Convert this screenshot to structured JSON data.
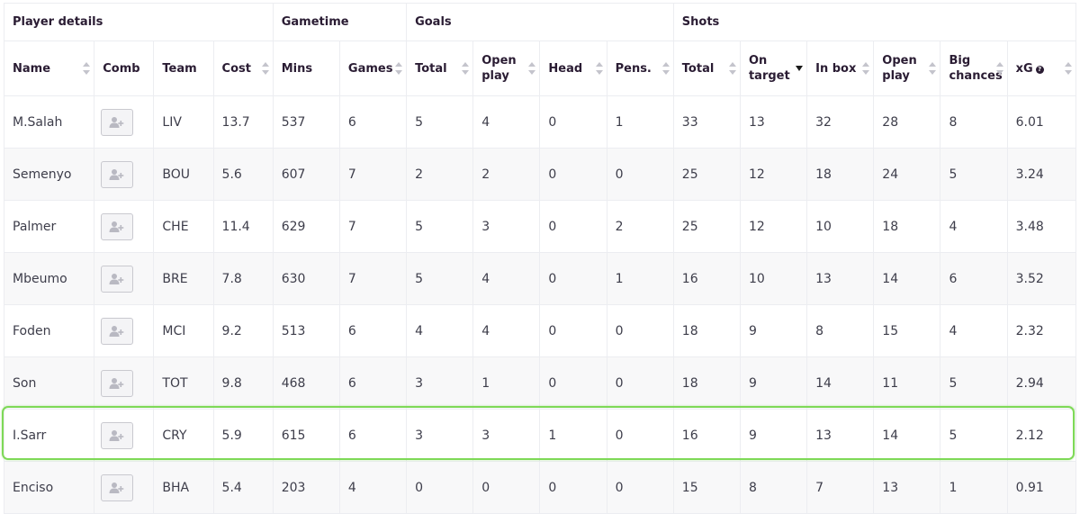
{
  "group_headers": {
    "player_details": "Player details",
    "gametime": "Gametime",
    "goals": "Goals",
    "shots": "Shots"
  },
  "columns": {
    "name": "Name",
    "comb": "Comb",
    "team": "Team",
    "cost": "Cost",
    "mins": "Mins",
    "games": "Games",
    "goals_total": "Total",
    "goals_open_play": "Open play",
    "head": "Head",
    "pens": "Pens.",
    "shots_total": "Total",
    "on_target": "On target",
    "in_box": "In box",
    "shots_open_play": "Open play",
    "big_chances": "Big chances",
    "xg": "xG"
  },
  "sorted_column": "On target",
  "rows": [
    {
      "name": "M.Salah",
      "team": "LIV",
      "cost": "13.7",
      "mins": "537",
      "games": "6",
      "g_total": "5",
      "g_open": "4",
      "head": "0",
      "pens": "1",
      "s_total": "33",
      "on_target": "13",
      "in_box": "32",
      "s_open": "28",
      "big": "8",
      "xg": "6.01"
    },
    {
      "name": "Semenyo",
      "team": "BOU",
      "cost": "5.6",
      "mins": "607",
      "games": "7",
      "g_total": "2",
      "g_open": "2",
      "head": "0",
      "pens": "0",
      "s_total": "25",
      "on_target": "12",
      "in_box": "18",
      "s_open": "24",
      "big": "5",
      "xg": "3.24"
    },
    {
      "name": "Palmer",
      "team": "CHE",
      "cost": "11.4",
      "mins": "629",
      "games": "7",
      "g_total": "5",
      "g_open": "3",
      "head": "0",
      "pens": "2",
      "s_total": "25",
      "on_target": "12",
      "in_box": "10",
      "s_open": "18",
      "big": "4",
      "xg": "3.48"
    },
    {
      "name": "Mbeumo",
      "team": "BRE",
      "cost": "7.8",
      "mins": "630",
      "games": "7",
      "g_total": "5",
      "g_open": "4",
      "head": "0",
      "pens": "1",
      "s_total": "16",
      "on_target": "10",
      "in_box": "13",
      "s_open": "14",
      "big": "6",
      "xg": "3.52"
    },
    {
      "name": "Foden",
      "team": "MCI",
      "cost": "9.2",
      "mins": "513",
      "games": "6",
      "g_total": "4",
      "g_open": "4",
      "head": "0",
      "pens": "0",
      "s_total": "18",
      "on_target": "9",
      "in_box": "8",
      "s_open": "15",
      "big": "4",
      "xg": "2.32"
    },
    {
      "name": "Son",
      "team": "TOT",
      "cost": "9.8",
      "mins": "468",
      "games": "6",
      "g_total": "3",
      "g_open": "1",
      "head": "0",
      "pens": "0",
      "s_total": "18",
      "on_target": "9",
      "in_box": "14",
      "s_open": "11",
      "big": "5",
      "xg": "2.94"
    },
    {
      "name": "I.Sarr",
      "team": "CRY",
      "cost": "5.9",
      "mins": "615",
      "games": "6",
      "g_total": "3",
      "g_open": "3",
      "head": "1",
      "pens": "0",
      "s_total": "16",
      "on_target": "9",
      "in_box": "13",
      "s_open": "14",
      "big": "5",
      "xg": "2.12"
    },
    {
      "name": "Enciso",
      "team": "BHA",
      "cost": "5.4",
      "mins": "203",
      "games": "4",
      "g_total": "0",
      "g_open": "0",
      "head": "0",
      "pens": "0",
      "s_total": "15",
      "on_target": "8",
      "in_box": "7",
      "s_open": "13",
      "big": "1",
      "xg": "0.91"
    }
  ],
  "highlighted_player": "I.Sarr",
  "colors": {
    "highlight_border": "#7ed957",
    "row_stripe": "#f8f8f9",
    "header_text": "#2a1c33"
  },
  "icons": {
    "comb": "add-user-icon",
    "sort": "sort-arrows-icon",
    "xg_help": "question-circle-icon"
  }
}
